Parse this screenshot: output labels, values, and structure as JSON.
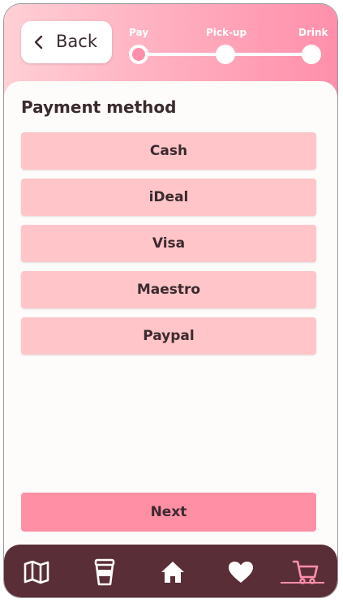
{
  "header": {
    "back_label": "Back",
    "steps": [
      "Pay",
      "Pick-up",
      "Drink"
    ],
    "active_step": "Pay"
  },
  "payment": {
    "title": "Payment method",
    "options": [
      "Cash",
      "iDeal",
      "Visa",
      "Maestro",
      "Paypal"
    ]
  },
  "actions": {
    "next_label": "Next"
  },
  "nav": {
    "items": [
      "map-icon",
      "cup-icon",
      "home-icon",
      "heart-icon",
      "cart-icon"
    ],
    "active": "cart-icon"
  },
  "colors": {
    "header_gradient_start": "#ffd0d6",
    "header_gradient_end": "#ff8fab",
    "option_bg": "#ffc5c8",
    "next_bg": "#ff8fa5",
    "nav_bg": "#5a2e36",
    "text": "#3b2a2e"
  }
}
